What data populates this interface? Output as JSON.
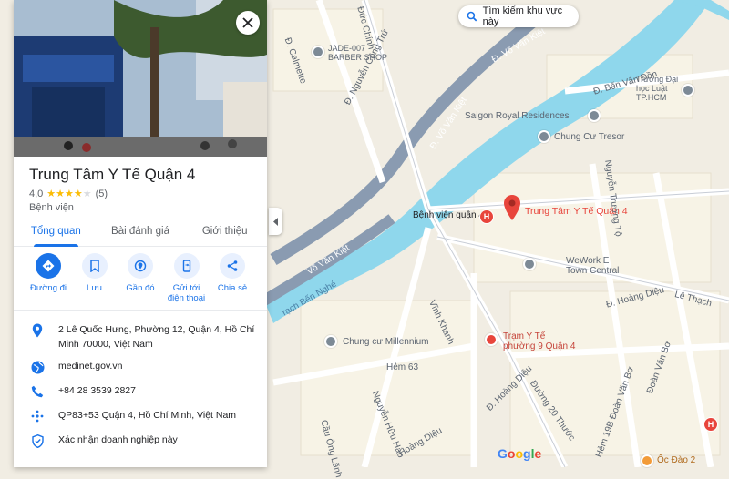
{
  "search_area": {
    "label": "Tìm kiếm khu vực này"
  },
  "place": {
    "name": "Trung Tâm Y Tế Quận 4",
    "rating": "4,0",
    "stars": 4,
    "review_count": "(5)",
    "category": "Bệnh viện"
  },
  "tabs": [
    {
      "label": "Tổng quan",
      "active": true
    },
    {
      "label": "Bài đánh giá",
      "active": false
    },
    {
      "label": "Giới thiệu",
      "active": false
    }
  ],
  "actions": [
    {
      "label": "Đường đi",
      "icon": "directions-icon"
    },
    {
      "label": "Lưu",
      "icon": "bookmark-icon"
    },
    {
      "label": "Gần đó",
      "icon": "nearby-icon"
    },
    {
      "label": "Gửi tới điện thoại",
      "icon": "send-to-phone-icon"
    },
    {
      "label": "Chia sẻ",
      "icon": "share-icon"
    }
  ],
  "info": {
    "address": "2 Lê Quốc Hưng, Phường 12, Quận 4, Hồ Chí Minh 70000, Việt Nam",
    "website": "medinet.gov.vn",
    "phone": "+84 28 3539 2827",
    "plus_code": "QP83+53 Quận 4, Hồ Chí Minh, Việt Nam",
    "claim": "Xác nhận doanh nghiệp này"
  },
  "map": {
    "selected_label": "Trung Tâm Y Tế Quận 4",
    "places": [
      {
        "name": "JADE-007",
        "name2": "BARBER SHOP"
      },
      {
        "name": "Saigon Royal Residences"
      },
      {
        "name": "Chung Cư Tresor"
      },
      {
        "name": "Trường Đại",
        "name2": "học Luật",
        "name3": "TP.HCM"
      },
      {
        "name": "Bệnh viện quận 4"
      },
      {
        "name": "WeWork E",
        "name2": "Town Central"
      },
      {
        "name": "Chung cư Millennium"
      },
      {
        "name": "Trạm Y Tế",
        "name2": "phường 9 Quận 4"
      },
      {
        "name": "Ốc Đào 2"
      }
    ],
    "streets": [
      "Đ. Calmette",
      "Đức Chính",
      "Đ. Nguyễn Công Trứ",
      "Đ. Võ Văn Kiệt",
      "Cầu Ông Lãnh",
      "Đ. Bến Vân Đồn",
      "Nguyễn Trường Tộ",
      "Đ. Hoàng Diệu",
      "Lê Thạch",
      "Vĩnh Khánh",
      "Hẻm 63",
      "Nguyễn Hữu Hào",
      "Đoàn Văn Bơ",
      "Đường 20 Thước",
      "Hẻm 19B Đoàn Văn Bơ",
      "rạch Bến Nghé",
      "Hoàng Diệu",
      "Võ Văn Kiệt"
    ],
    "logo": "Google"
  }
}
